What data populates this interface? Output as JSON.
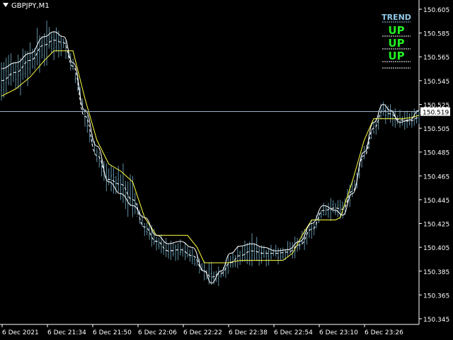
{
  "window": {
    "symbol_title": "GBPJPY,M1"
  },
  "colors": {
    "background": "#000000",
    "axis": "#ffffff",
    "bars": "#5f8fa3",
    "upper_band": "#ffffff",
    "middle_band": "#ffffff",
    "lower_band": "#ffff44",
    "price_line": "#9fb4c8",
    "trend_header": "#8fc8e8",
    "trend_up": "#22ee22"
  },
  "price_scale": {
    "min": 150.345,
    "max": 150.605,
    "ticks": [
      "150.605",
      "150.585",
      "150.565",
      "150.545",
      "150.525",
      "150.505",
      "150.485",
      "150.465",
      "150.445",
      "150.425",
      "150.405",
      "150.385",
      "150.365",
      "150.345"
    ],
    "current_price": "150.519",
    "current_value": 150.519
  },
  "time_scale": {
    "labels": [
      "6 Dec 2021",
      "6 Dec 21:34",
      "6 Dec 21:50",
      "6 Dec 22:06",
      "6 Dec 22:22",
      "6 Dec 22:38",
      "6 Dec 22:54",
      "6 Dec 23:10",
      "6 Dec 23:26"
    ]
  },
  "trend_panel": {
    "header": "TREND",
    "rows": [
      "UP",
      "UP",
      "UP"
    ]
  },
  "chart_data": {
    "type": "line",
    "upper_band": [
      [
        0,
        150.555
      ],
      [
        6,
        150.56
      ],
      [
        12,
        150.568
      ],
      [
        18,
        150.582
      ],
      [
        22,
        150.586
      ],
      [
        26,
        150.582
      ],
      [
        30,
        150.56
      ],
      [
        35,
        150.52
      ],
      [
        40,
        150.49
      ],
      [
        45,
        150.46
      ],
      [
        50,
        150.45
      ],
      [
        55,
        150.44
      ],
      [
        60,
        150.43
      ],
      [
        65,
        150.415
      ],
      [
        70,
        150.408
      ],
      [
        75,
        150.41
      ],
      [
        80,
        150.405
      ],
      [
        85,
        150.385
      ],
      [
        88,
        150.375
      ],
      [
        92,
        150.385
      ],
      [
        96,
        150.4
      ],
      [
        100,
        150.406
      ],
      [
        105,
        150.408
      ],
      [
        110,
        150.405
      ],
      [
        115,
        150.402
      ],
      [
        120,
        150.403
      ],
      [
        125,
        150.41
      ],
      [
        130,
        150.425
      ],
      [
        135,
        150.44
      ],
      [
        140,
        150.436
      ],
      [
        143,
        150.432
      ],
      [
        147,
        150.45
      ],
      [
        152,
        150.485
      ],
      [
        156,
        150.51
      ],
      [
        160,
        150.525
      ],
      [
        163,
        150.52
      ],
      [
        167,
        150.51
      ],
      [
        171,
        150.512
      ],
      [
        175,
        150.52
      ]
    ],
    "middle_band": [
      [
        0,
        150.545
      ],
      [
        6,
        150.552
      ],
      [
        12,
        150.562
      ],
      [
        18,
        150.575
      ],
      [
        22,
        150.579
      ],
      [
        26,
        150.577
      ],
      [
        30,
        150.557
      ],
      [
        35,
        150.515
      ],
      [
        40,
        150.482
      ],
      [
        45,
        150.462
      ],
      [
        50,
        150.458
      ],
      [
        55,
        150.445
      ],
      [
        60,
        150.422
      ],
      [
        65,
        150.41
      ],
      [
        70,
        150.402
      ],
      [
        75,
        150.403
      ],
      [
        80,
        150.398
      ],
      [
        85,
        150.385
      ],
      [
        88,
        150.38
      ],
      [
        92,
        150.383
      ],
      [
        96,
        150.392
      ],
      [
        100,
        150.398
      ],
      [
        105,
        150.402
      ],
      [
        110,
        150.4
      ],
      [
        115,
        150.4
      ],
      [
        120,
        150.401
      ],
      [
        125,
        150.407
      ],
      [
        130,
        150.42
      ],
      [
        135,
        150.436
      ],
      [
        140,
        150.438
      ],
      [
        143,
        150.437
      ],
      [
        147,
        150.452
      ],
      [
        152,
        150.482
      ],
      [
        156,
        150.505
      ],
      [
        160,
        150.52
      ],
      [
        163,
        150.517
      ],
      [
        167,
        150.512
      ],
      [
        171,
        150.511
      ],
      [
        175,
        150.514
      ]
    ],
    "lower_band": [
      [
        0,
        150.532
      ],
      [
        6,
        150.538
      ],
      [
        12,
        150.548
      ],
      [
        18,
        150.562
      ],
      [
        22,
        150.57
      ],
      [
        30,
        150.57
      ],
      [
        35,
        150.53
      ],
      [
        40,
        150.495
      ],
      [
        45,
        150.475
      ],
      [
        50,
        150.469
      ],
      [
        55,
        150.46
      ],
      [
        60,
        150.43
      ],
      [
        65,
        150.415
      ],
      [
        78,
        150.415
      ],
      [
        82,
        150.405
      ],
      [
        85,
        150.392
      ],
      [
        95,
        150.392
      ],
      [
        100,
        150.394
      ],
      [
        110,
        150.394
      ],
      [
        118,
        150.394
      ],
      [
        122,
        150.4
      ],
      [
        126,
        150.415
      ],
      [
        130,
        150.428
      ],
      [
        140,
        150.428
      ],
      [
        142,
        150.43
      ],
      [
        147,
        150.46
      ],
      [
        152,
        150.495
      ],
      [
        156,
        150.513
      ],
      [
        168,
        150.513
      ],
      [
        172,
        150.514
      ],
      [
        175,
        150.516
      ]
    ]
  }
}
